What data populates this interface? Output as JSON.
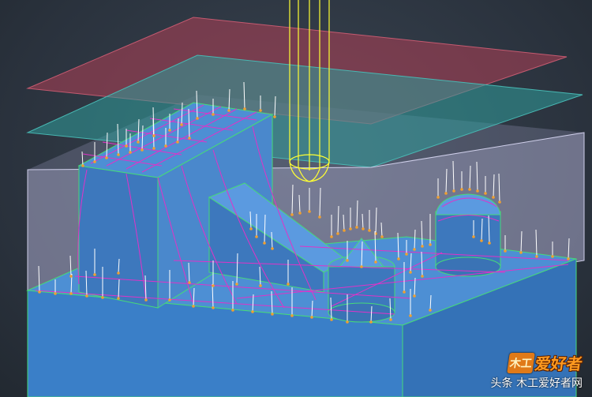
{
  "viewport": {
    "background": "#2b3440",
    "colors": {
      "part_top": "#4d8fd4",
      "part_side": "#3d78bd",
      "part_edge": "#46d97a",
      "stock_box": "#b7b7d9",
      "upper_plane": "#b14055",
      "lower_plane": "#2f9d9a",
      "tool": "#ffff33",
      "toolpath": "#e033c8",
      "vector_line": "#ffffff",
      "vector_dot": "#f0a030"
    }
  },
  "watermark": {
    "logo_mark": "木工",
    "logo_text": "爱好者",
    "caption": "头条  木工爱好者网"
  }
}
